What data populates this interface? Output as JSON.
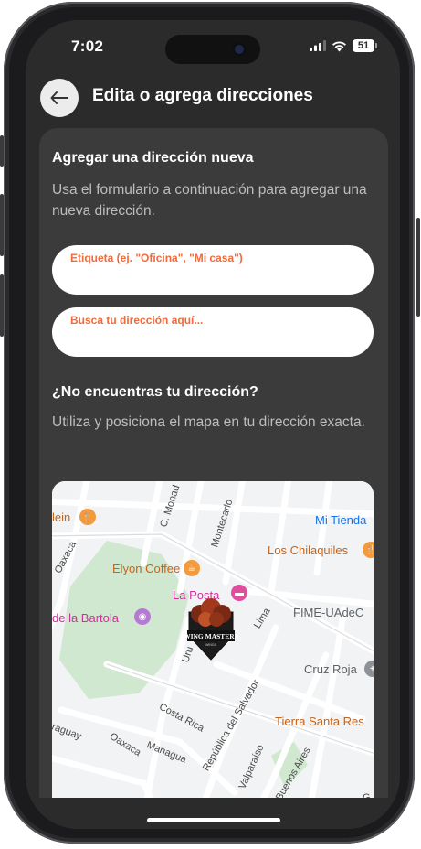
{
  "status_bar": {
    "time": "7:02",
    "battery": "51",
    "signal_icon": "cellular-signal-icon",
    "wifi_icon": "wifi-icon"
  },
  "header": {
    "back_icon": "arrow-left-icon",
    "title": "Edita o agrega direcciones"
  },
  "form": {
    "title": "Agregar una dirección nueva",
    "description": "Usa el formulario a continuación para agregar una nueva dirección.",
    "label_placeholder": "Etiqueta (ej. \"Oficina\", \"Mi casa\")",
    "label_value": "",
    "search_placeholder": "Busca tu dirección aquí...",
    "search_value": ""
  },
  "help": {
    "title": "¿No encuentras tu dirección?",
    "description": "Utiliza y posiciona el mapa en tu dirección exacta."
  },
  "map": {
    "places": {
      "lein": "lein",
      "mi_tienda": "Mi Tienda",
      "elyon": "Elyon Coffee",
      "chilaquiles": "Los Chilaquiles",
      "la_posta": "La Posta",
      "bartola": "de la Bartola",
      "fime": "FIME-UAdeC",
      "cruz_roja": "Cruz Roja",
      "tierra": "Tierra Santa Res"
    },
    "streets": {
      "oaxaca1": "Oaxaca",
      "c_monad": "C. Monad",
      "montecarlo": "Montecarlo",
      "lima": "Lima",
      "uru": "Uru",
      "costa_rica": "Costa Rica",
      "republica": "República del Salvador",
      "managua": "Managua",
      "oaxaca2": "Oaxaca",
      "araguay": "raguay",
      "valparaiso": "Valparaíso",
      "buenos_aires": "Buenos Aires",
      "g": "G"
    },
    "marker": {
      "line1": "WING MASTERS",
      "line2": "WINGS"
    },
    "colors": {
      "park": "#c8e6c9",
      "road": "#ffffff",
      "orange_poi": "#f29a3d",
      "pink_poi": "#e24c9f",
      "gray_poi": "#8e9298"
    }
  },
  "colors": {
    "background": "#2b2b2b",
    "card": "#3b3b3b",
    "accent": "#f06a3c"
  }
}
